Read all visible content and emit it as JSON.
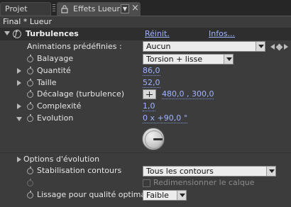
{
  "tabs": {
    "projet": "Projet",
    "effets": "Effets Lueur"
  },
  "composition_title": "Final * Lueur",
  "effect": {
    "name": "Turbulences",
    "reset_link": "Réinit.",
    "about_link": "Infos..."
  },
  "animation_presets": {
    "label": "Animations prédéfinies :",
    "value": "Aucun"
  },
  "params": {
    "balayage": {
      "label": "Balayage",
      "value": "Torsion + lisse"
    },
    "quantite": {
      "label": "Quantité",
      "value": "86,0"
    },
    "taille": {
      "label": "Taille",
      "value": "52,0"
    },
    "decalage": {
      "label": "Décalage (turbulence)",
      "value": "480,0 , 300,0"
    },
    "complexite": {
      "label": "Complexité",
      "value": "1,0"
    },
    "evolution": {
      "label": "Evolution",
      "value": "0 x +90,0 °",
      "angle_deg": 90
    },
    "options": {
      "label": "Options d'évolution"
    },
    "stabilisation": {
      "label": "Stabilisation contours",
      "value": "Tous les contours"
    },
    "redim": {
      "label": "Redimensionner le calque",
      "checked": false
    },
    "lissage": {
      "label": "Lissage pour qualité optimale",
      "value": "Faible"
    }
  },
  "icons": {
    "lock": "lock-icon",
    "menu": "tab-menu-icon",
    "close": "close-icon",
    "stopwatch": "stopwatch-icon"
  },
  "colors": {
    "value_blue": "#9fb4ff",
    "panel_bg": "#3c3c3c"
  }
}
